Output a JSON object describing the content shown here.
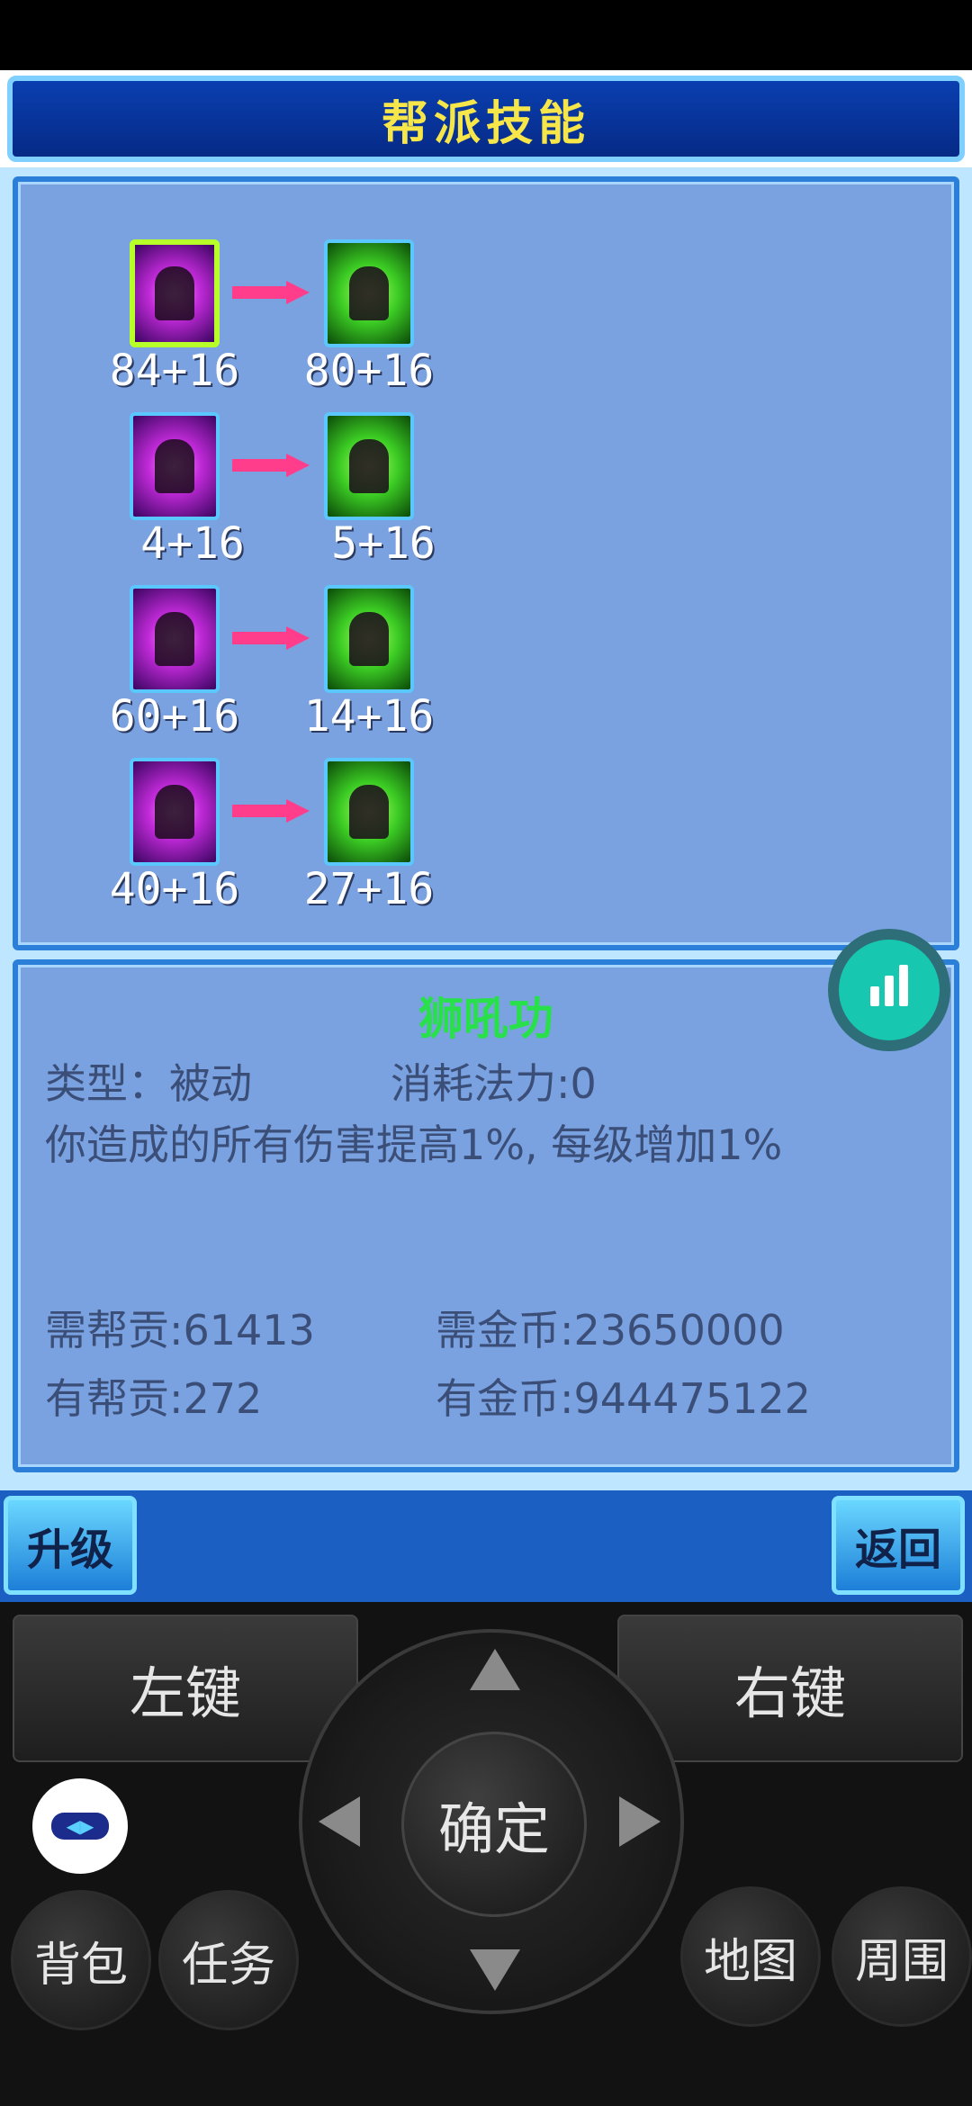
{
  "title": "帮派技能",
  "skills": [
    {
      "from_level": "84+16",
      "to_level": "80+16"
    },
    {
      "from_level": "4+16",
      "to_level": "5+16"
    },
    {
      "from_level": "60+16",
      "to_level": "14+16"
    },
    {
      "from_level": "40+16",
      "to_level": "27+16"
    }
  ],
  "detail": {
    "name": "狮吼功",
    "type_label": "类型：被动",
    "cost_label": "消耗法力:0",
    "description": "你造成的所有伤害提高1%, 每级增加1%",
    "need_contribution": "需帮贡:61413",
    "need_gold": "需金币:23650000",
    "have_contribution": "有帮贡:272",
    "have_gold": "有金币:944475122"
  },
  "buttons": {
    "upgrade": "升级",
    "back": "返回"
  },
  "controller": {
    "left_key": "左键",
    "right_key": "右键",
    "confirm": "确定",
    "bag": "背包",
    "task": "任务",
    "map": "地图",
    "around": "周围"
  },
  "icons": {
    "stats": "bar-chart-icon",
    "assist": "speed-assist-icon"
  },
  "colors": {
    "title_text": "#f7e64a",
    "skill_name": "#28e04a",
    "arrow": "#ff3d8a",
    "panel_bg": "#7aa1e0"
  }
}
